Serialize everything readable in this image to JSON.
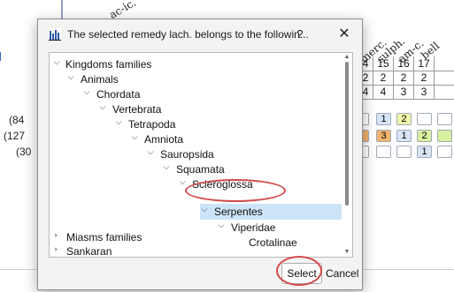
{
  "dialog": {
    "title": "The selected remedy lach. belongs to the followin...",
    "help_label": "?",
    "close_label": "✕",
    "select_label": "Select",
    "cancel_label": "Cancel"
  },
  "tree": {
    "nodes": [
      {
        "label": "Kingdoms families",
        "expanded": true
      },
      {
        "label": "Animals",
        "expanded": true
      },
      {
        "label": "Chordata",
        "expanded": true
      },
      {
        "label": "Vertebrata",
        "expanded": true
      },
      {
        "label": "Tetrapoda",
        "expanded": true
      },
      {
        "label": "Amniota",
        "expanded": true
      },
      {
        "label": "Sauropsida",
        "expanded": true
      },
      {
        "label": "Squamata",
        "expanded": true
      },
      {
        "label": "Scleroglossa",
        "expanded": true
      },
      {
        "label": "Serpentes",
        "expanded": true,
        "selected": true
      },
      {
        "label": "Viperidae",
        "expanded": true
      },
      {
        "label": "Crotalinae",
        "expanded": null
      },
      {
        "label": "Miasms families",
        "expanded": false
      },
      {
        "label": "Sankaran",
        "expanded": false
      }
    ]
  },
  "background": {
    "left_labels": [
      "(84",
      "(127",
      "(30"
    ],
    "column_headers": [
      "ac-ic.",
      "merc.",
      "sulph.",
      "am-c.",
      "bell"
    ],
    "header_row": [
      "4",
      "15",
      "16",
      "17"
    ],
    "row1": [
      "2",
      "2",
      "2",
      "2"
    ],
    "row2": [
      "4",
      "4",
      "3",
      "3"
    ],
    "cells_row1": [
      "1",
      "2"
    ],
    "cells_row2": [
      "3",
      "1",
      "2"
    ],
    "cells_row3": [
      "1"
    ]
  },
  "colors": {
    "selection": "#cce4f7",
    "annotation_red": "#d24a4a",
    "cell_blue": "#d6e4f5",
    "cell_yellow": "#eef5a8",
    "cell_orange": "#f0b46e",
    "cell_green": "#d8f0a0"
  },
  "icons": {
    "app": "bar-chart-icon",
    "expand": "chevron-down-icon",
    "collapsed": "chevron-right-icon"
  }
}
